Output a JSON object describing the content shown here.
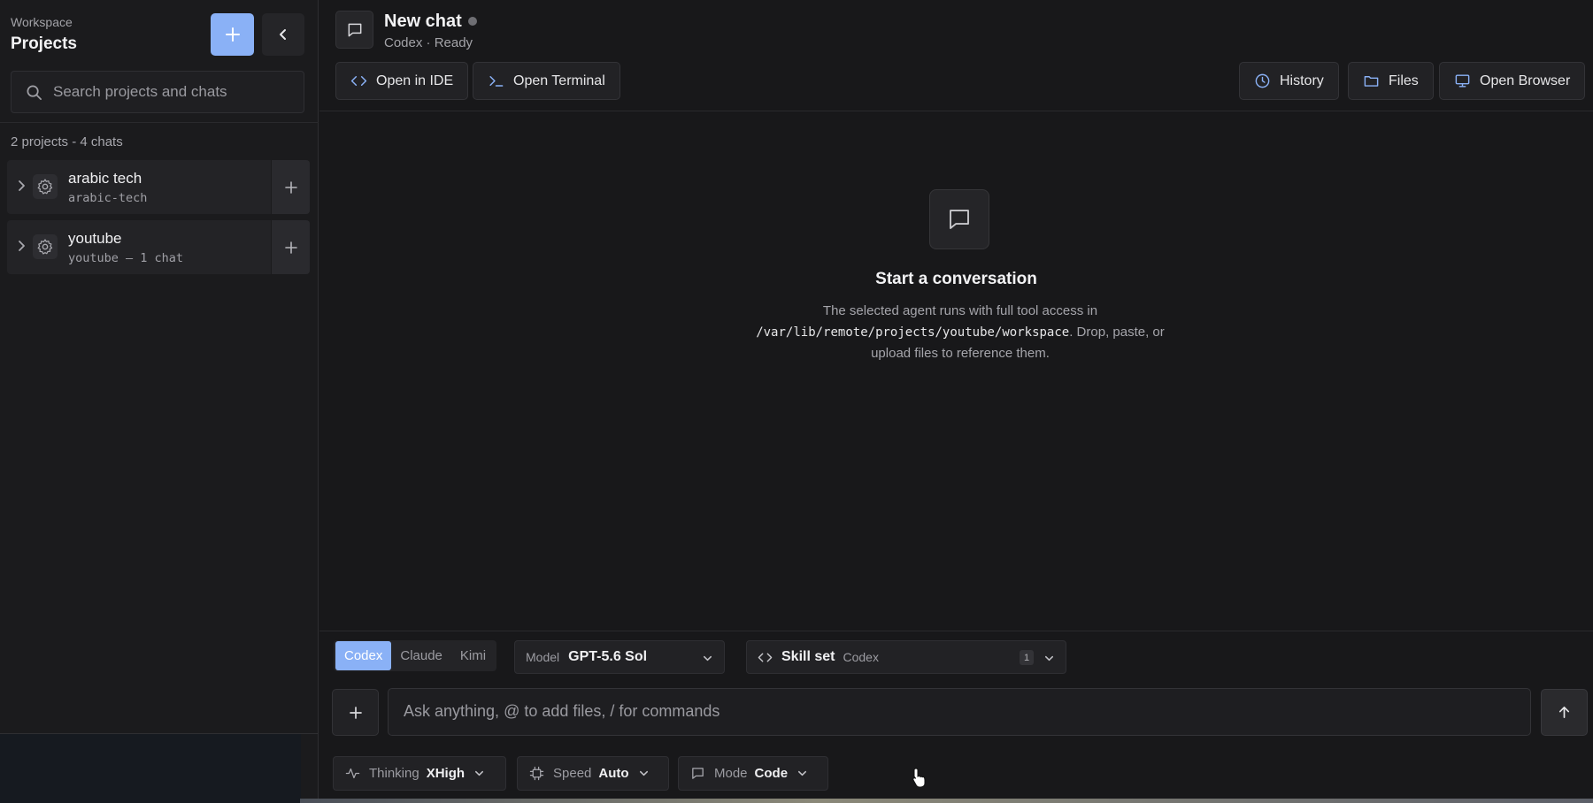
{
  "sidebar": {
    "workspace_label": "Workspace",
    "title": "Projects",
    "search_placeholder": "Search projects and chats",
    "counts": "2 projects - 4 chats",
    "projects": [
      {
        "name": "arabic tech",
        "slug": "arabic-tech"
      },
      {
        "name": "youtube",
        "slug": "youtube – 1 chat"
      }
    ]
  },
  "header": {
    "title": "New chat",
    "subtitle": "Codex · Ready",
    "buttons": {
      "open_ide": "Open in IDE",
      "open_terminal": "Open Terminal",
      "history": "History",
      "files": "Files",
      "open_browser": "Open Browser"
    }
  },
  "empty_state": {
    "title": "Start a conversation",
    "desc_before": "The selected agent runs with full tool access in",
    "path": "/var/lib/remote/projects/youtube/workspace",
    "desc_after": ". Drop, paste, or upload files to reference them."
  },
  "composer": {
    "agents": [
      "Codex",
      "Claude",
      "Kimi"
    ],
    "active_agent": "Codex",
    "model": {
      "label": "Model",
      "value": "GPT-5.6 Sol"
    },
    "skill_set": {
      "label": "Skill set",
      "value": "Codex",
      "count": "1"
    },
    "placeholder": "Ask anything, @ to add files, / for commands",
    "options": {
      "thinking": {
        "label": "Thinking",
        "value": "XHigh"
      },
      "speed": {
        "label": "Speed",
        "value": "Auto"
      },
      "mode": {
        "label": "Mode",
        "value": "Code"
      }
    }
  },
  "colors": {
    "accent": "#8ab1f6",
    "background": "#18181a",
    "sidebar": "#1b1b1d",
    "panel": "#222225"
  },
  "icons": [
    "plus-icon",
    "chevron-left-icon",
    "search-icon",
    "chevron-right-icon",
    "gear-icon",
    "chat-bubble-icon",
    "code-icon",
    "terminal-icon",
    "clock-icon",
    "folder-icon",
    "monitor-icon",
    "chevron-down-icon",
    "arrow-up-icon",
    "activity-icon",
    "cpu-icon",
    "cursor-icon"
  ]
}
